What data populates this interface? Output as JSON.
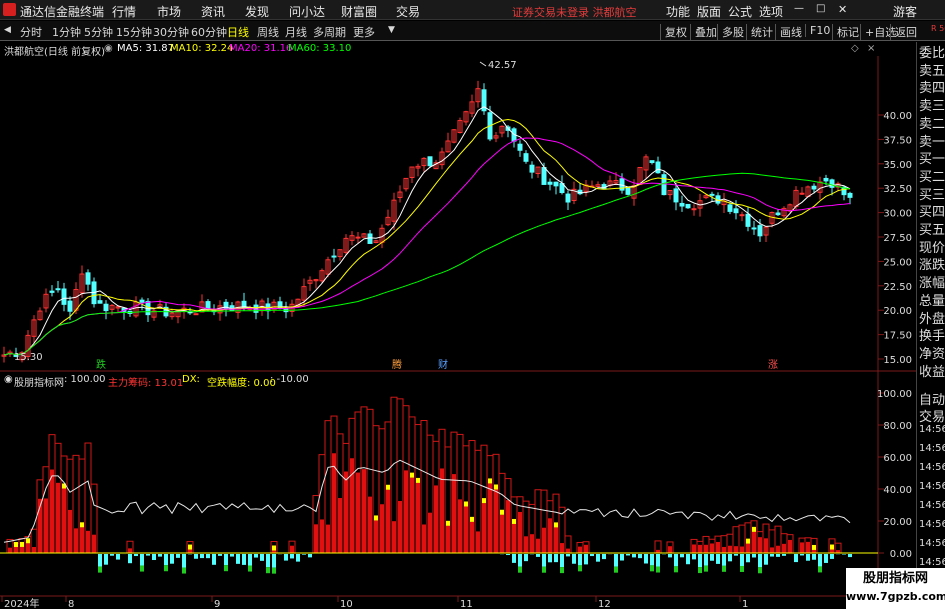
{
  "menubar": {
    "app_title": "通达信金融终端",
    "menus": [
      "行情",
      "市场",
      "资讯",
      "发现",
      "问小达",
      "财富圈",
      "交易"
    ],
    "notice": "证券交易未登录 洪都航空",
    "right_items": [
      "功能",
      "版面",
      "公式",
      "选项"
    ],
    "guest": "游客"
  },
  "toolbar": {
    "periods": [
      "分时",
      "1分钟",
      "5分钟",
      "15分钟",
      "30分钟",
      "60分钟",
      "日线",
      "周线",
      "月线",
      "多周期",
      "更多"
    ],
    "active_period": "日线",
    "right_buttons": [
      "复权",
      "叠加",
      "多股",
      "统计",
      "画线",
      "F10",
      "标记",
      "+自选",
      "返回"
    ]
  },
  "info": {
    "stock": "洪都航空(日线 前复权)",
    "ma5": "MA5: 31.87",
    "ma10": "MA10: 32.24",
    "ma20": "MA20: 31.16",
    "ma60": "MA60: 33.10"
  },
  "indicator": {
    "name": "股朋指标网",
    "value1": ": 100.00",
    "chip": "主力筹码: 13.01",
    "dx": "DX:",
    "fall": "空跌幅度: 0.00",
    "fall2": ": -10.00"
  },
  "price_axis": [
    "40.00",
    "37.50",
    "35.00",
    "32.50",
    "30.00",
    "27.50",
    "25.00",
    "22.50",
    "20.00",
    "17.50",
    "15.00"
  ],
  "vol_axis": [
    "100.00",
    "80.00",
    "60.00",
    "40.00",
    "20.00",
    "0.00"
  ],
  "annotations": {
    "high": "42.57",
    "low": "15.30",
    "events": [
      "跌",
      "腾",
      "财",
      "涨"
    ]
  },
  "dates": [
    "2024年",
    "8",
    "9",
    "10",
    "11",
    "12",
    "1"
  ],
  "right_panel": {
    "labels": [
      "委比",
      "卖五",
      "卖四",
      "卖三",
      "卖二",
      "卖一",
      "买一",
      "买二",
      "买三",
      "买四",
      "买五",
      "现价",
      "涨跌",
      "涨幅",
      "总量",
      "外盘",
      "换手",
      "净资",
      "收益",
      "自动",
      "交易"
    ],
    "times": [
      "14:56",
      "14:56",
      "14:56",
      "14:56",
      "14:56",
      "14:56",
      "14:56",
      "14:56"
    ],
    "corner": "R 500"
  },
  "watermark": {
    "line1": "股朋指标网",
    "line2": "www.7gpzb.com"
  },
  "colors": {
    "up": "#ff3333",
    "down": "#54ffff",
    "ma5": "#ffffff",
    "ma10": "#ffff00",
    "ma20": "#ff00ff",
    "ma60": "#00ff00"
  }
}
